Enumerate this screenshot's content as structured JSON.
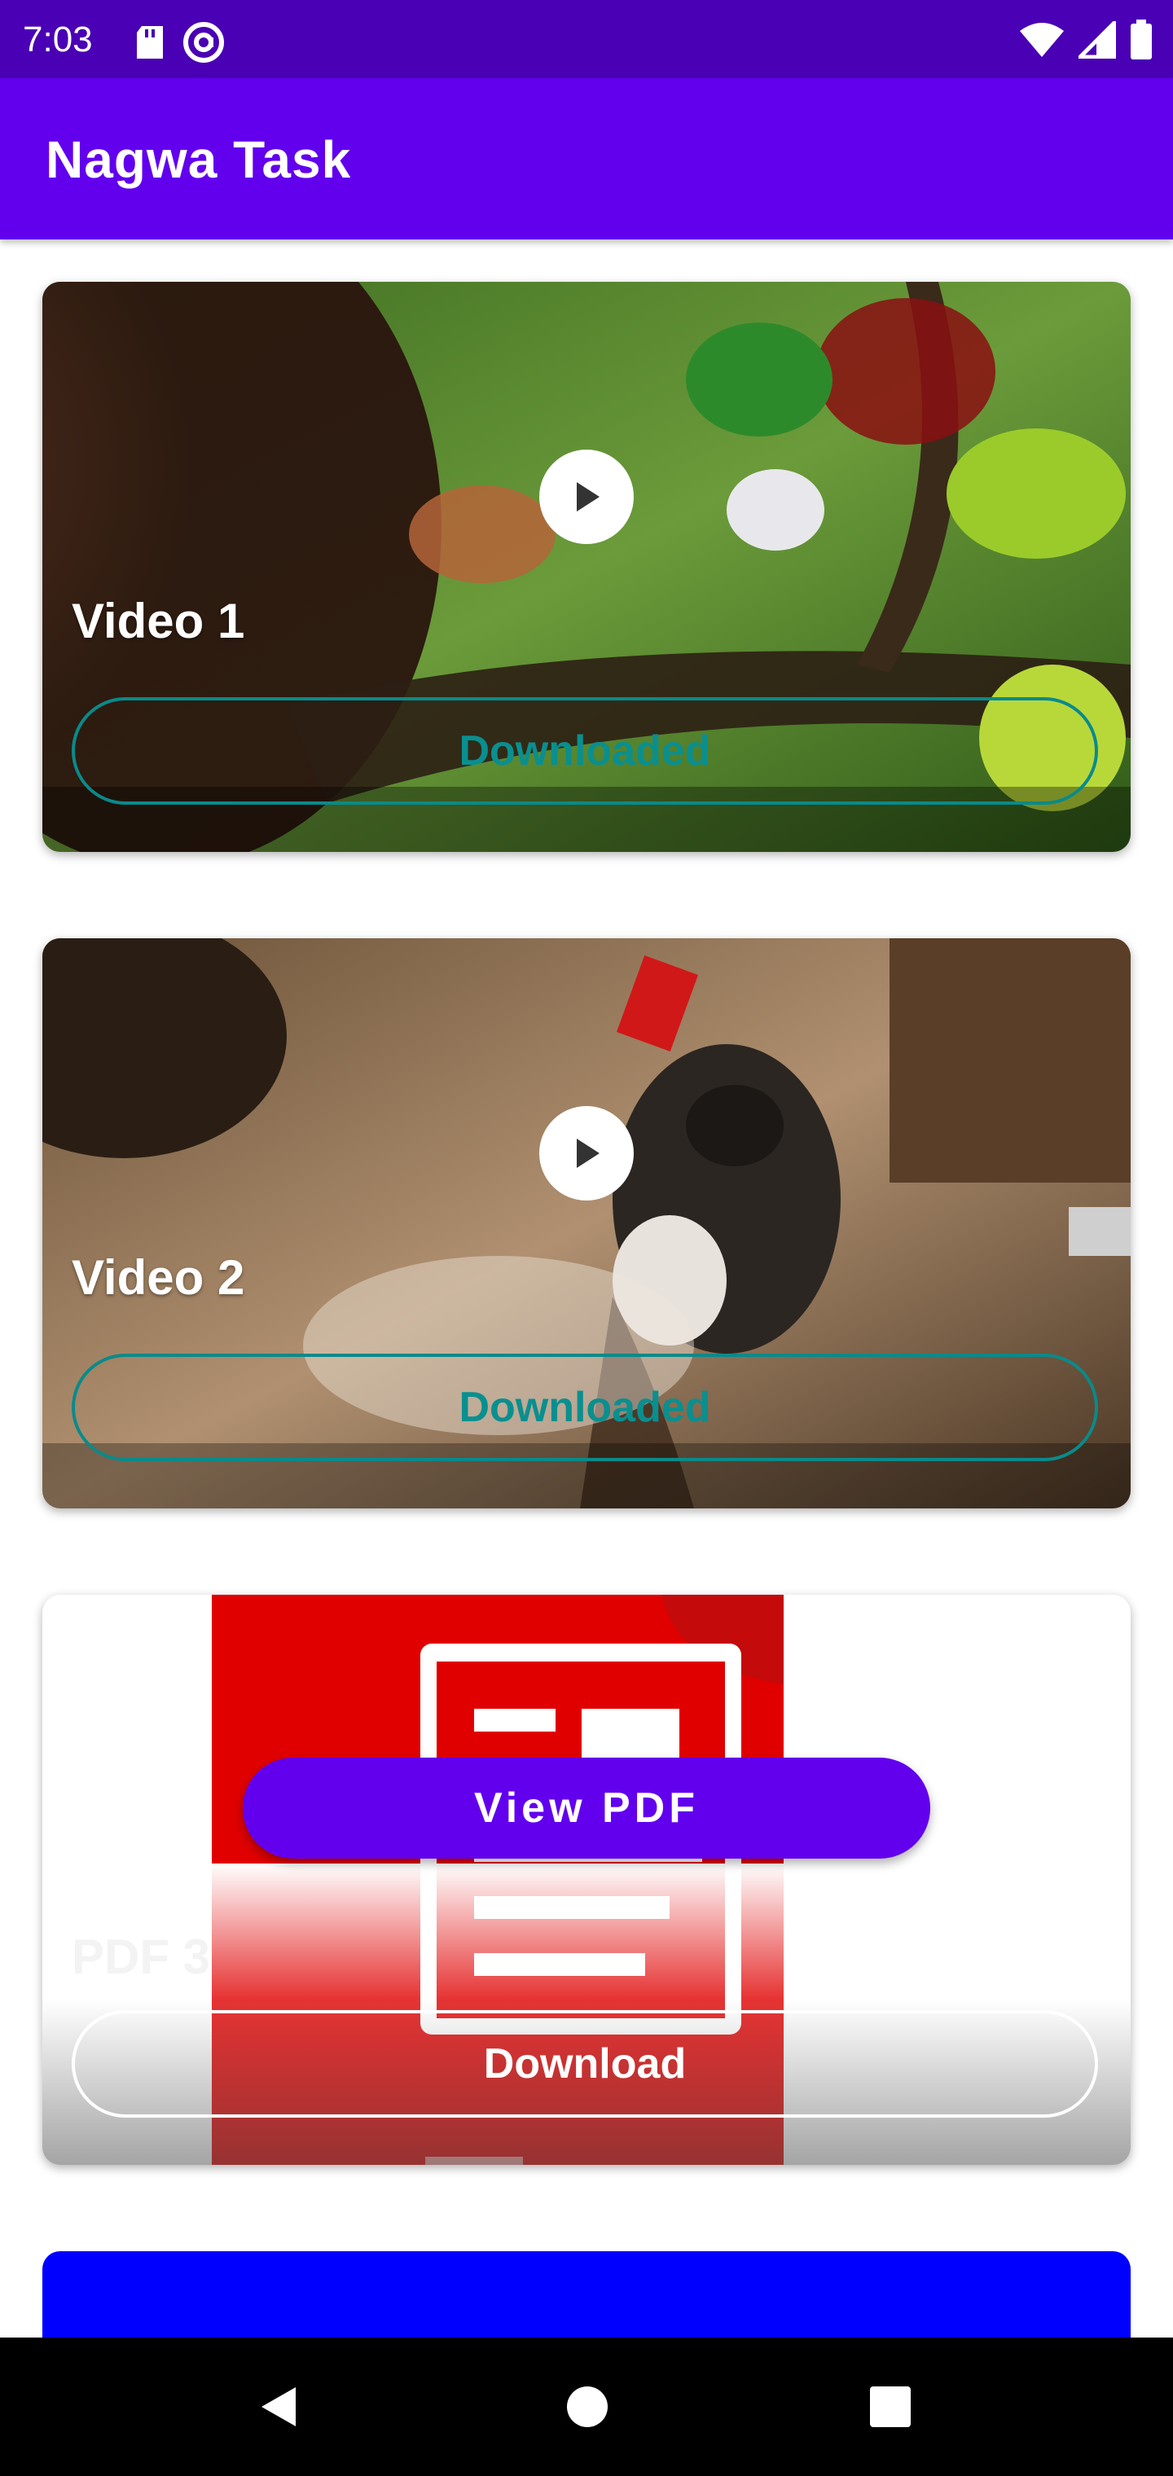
{
  "status_bar": {
    "time": "7:03",
    "icons_left": [
      "sd-card-icon",
      "at-sign-icon"
    ],
    "icons_right": [
      "wifi-icon",
      "signal-icon",
      "battery-icon"
    ]
  },
  "app_bar": {
    "title": "Nagwa Task",
    "color": "#6200ee"
  },
  "items": [
    {
      "type": "video",
      "title": "Video 1",
      "button_label": "Downloaded",
      "thumbnail": "animated forest scene"
    },
    {
      "type": "video",
      "title": "Video 2",
      "button_label": "Downloaded",
      "thumbnail": "cat on wooden floor"
    },
    {
      "type": "pdf",
      "title": "PDF 3",
      "view_label": "View PDF",
      "button_label": "Download"
    }
  ],
  "nav_bar": {
    "buttons": [
      "back-icon",
      "home-icon",
      "recents-icon"
    ]
  },
  "colors": {
    "accent": "#6200ee",
    "status_bar": "#4a00b4",
    "downloaded_text": "#0a8f8f",
    "blue_card": "#0000ff"
  }
}
